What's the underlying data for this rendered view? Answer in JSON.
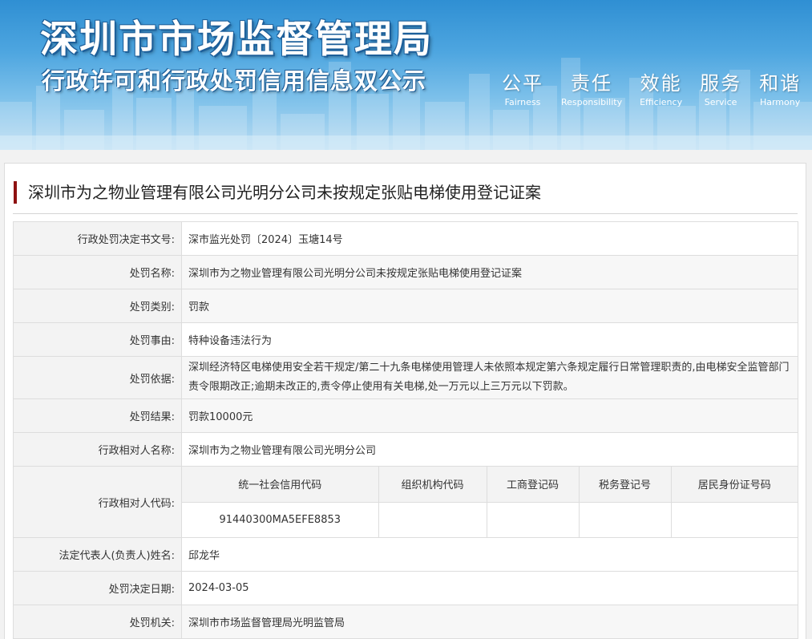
{
  "header": {
    "title": "深圳市市场监督管理局",
    "subtitle": "行政许可和行政处罚信用信息双公示",
    "slogans": [
      {
        "cn": "公平",
        "en": "Fairness"
      },
      {
        "cn": "责任",
        "en": "Responsibility"
      },
      {
        "cn": "效能",
        "en": "Efficiency"
      },
      {
        "cn": "服务",
        "en": "Service"
      },
      {
        "cn": "和谐",
        "en": "Harmony"
      }
    ]
  },
  "case": {
    "title": "深圳市为之物业管理有限公司光明分公司未按规定张贴电梯使用登记证案"
  },
  "rows": {
    "decision_no": {
      "label": "行政处罚决定书文号:",
      "value": "深市监光处罚〔2024〕玉塘14号"
    },
    "penalty_name": {
      "label": "处罚名称:",
      "value": "深圳市为之物业管理有限公司光明分公司未按规定张贴电梯使用登记证案"
    },
    "penalty_type": {
      "label": "处罚类别:",
      "value": "罚款"
    },
    "penalty_reason": {
      "label": "处罚事由:",
      "value": "特种设备违法行为"
    },
    "penalty_basis": {
      "label": "处罚依据:",
      "value": "深圳经济特区电梯使用安全若干规定/第二十九条电梯使用管理人未依照本规定第六条规定履行日常管理职责的,由电梯安全监管部门责令限期改正;逾期未改正的,责令停止使用有关电梯,处一万元以上三万元以下罚款。"
    },
    "penalty_result": {
      "label": "处罚结果:",
      "value": "罚款10000元"
    },
    "counterpart_name": {
      "label": "行政相对人名称:",
      "value": "深圳市为之物业管理有限公司光明分公司"
    },
    "counterpart_code": {
      "label": "行政相对人代码:",
      "headers": [
        "统一社会信用代码",
        "组织机构代码",
        "工商登记码",
        "税务登记号",
        "居民身份证号码"
      ],
      "values": [
        "91440300MA5EFE8853",
        "",
        "",
        "",
        ""
      ]
    },
    "legal_rep": {
      "label": "法定代表人(负责人)姓名:",
      "value": "邱龙华"
    },
    "decision_date": {
      "label": "处罚决定日期:",
      "value": "2024-03-05"
    },
    "authority": {
      "label": "处罚机关:",
      "value": "深圳市市场监督管理局光明监管局"
    }
  }
}
